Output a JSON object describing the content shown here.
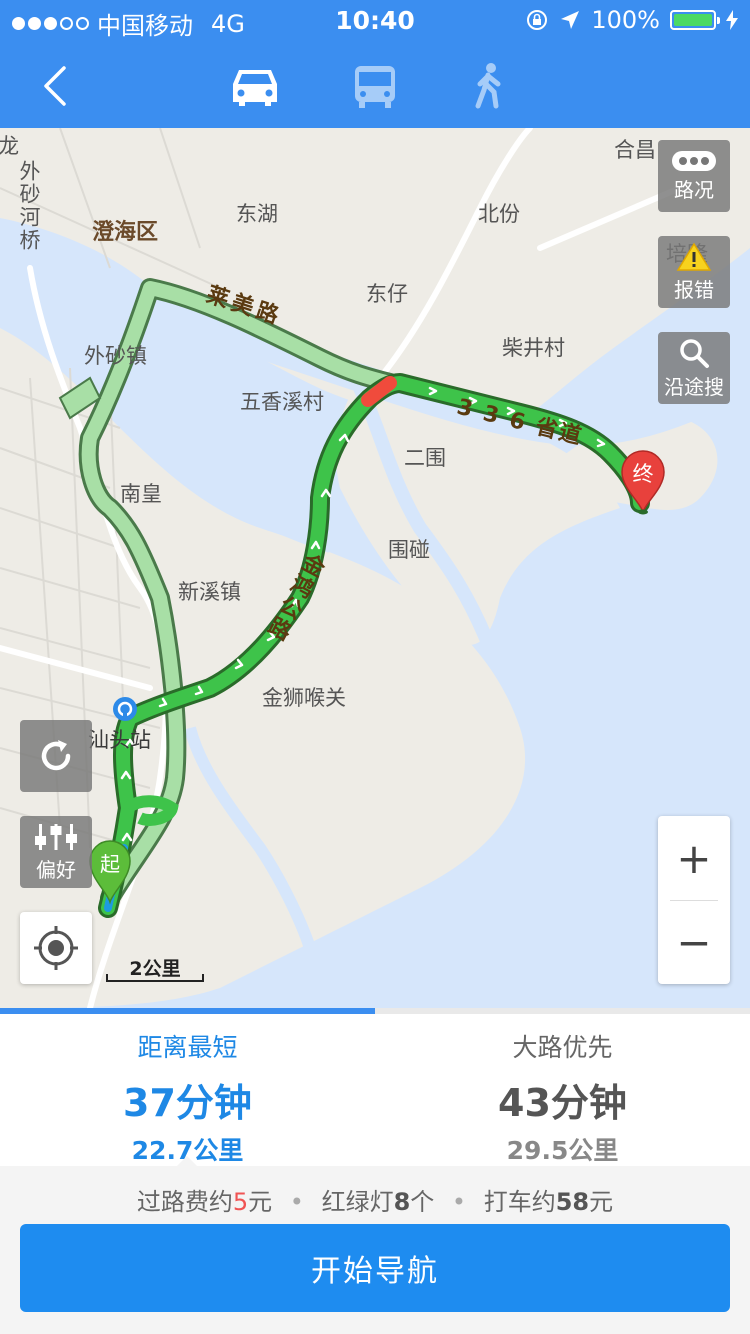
{
  "status": {
    "carrier": "中国移动",
    "network": "4G",
    "time": "10:40",
    "battery": "100%",
    "signal_strength": 3
  },
  "nav": {
    "back_icon": "chevron-left-icon",
    "modes": [
      {
        "id": "car",
        "icon": "car-icon",
        "selected": true
      },
      {
        "id": "bus",
        "icon": "bus-icon",
        "selected": false
      },
      {
        "id": "walk",
        "icon": "walk-icon",
        "selected": false
      }
    ]
  },
  "map": {
    "places": {
      "hechang": "合昌",
      "dongxu": "东湖",
      "beifen": "北份",
      "chenghai": "澄海区",
      "waisha_river": "外砂河桥",
      "waisha_town": "外砂镇",
      "longfragment": "龙",
      "dongzai": "东仔",
      "chaijing": "柴井村",
      "wuxiangxi": "五香溪村",
      "erwei": "二围",
      "nanhuang": "南皇",
      "weipeng": "围碰",
      "xinxi": "新溪镇",
      "jinshi": "金狮喉关",
      "shantou_station": "汕头站",
      "peilong": "培隆"
    },
    "roads": {
      "laimei": "莱美路",
      "provincial": "3 3 6 省道",
      "jinhong": "金鸿公路"
    },
    "markers": {
      "start": "起",
      "end": "终"
    },
    "buttons": {
      "traffic": "路况",
      "report": "报错",
      "search_along": "沿途搜",
      "preference": "偏好"
    },
    "zoom_in": "+",
    "zoom_out": "−",
    "scale": "2公里"
  },
  "routes": [
    {
      "name": "距离最短",
      "time": "37分钟",
      "distance": "22.7公里",
      "selected": true
    },
    {
      "name": "大路优先",
      "time": "43分钟",
      "distance": "29.5公里",
      "selected": false
    }
  ],
  "info": {
    "toll_prefix": "过路费约",
    "toll_value": "5",
    "toll_unit": "元",
    "lights_prefix": "红绿灯",
    "lights_value": "8",
    "lights_unit": "个",
    "taxi_prefix": "打车约",
    "taxi_value": "58",
    "taxi_unit": "元",
    "separator": "•"
  },
  "start_button": "开始导航",
  "colors": {
    "primary": "#3b8ef0",
    "route_green": "#3ec34a",
    "alt_route": "#a8dfa6",
    "jam_red": "#f04b3c",
    "end_marker": "#e8413c",
    "start_marker": "#5cbd3a"
  }
}
